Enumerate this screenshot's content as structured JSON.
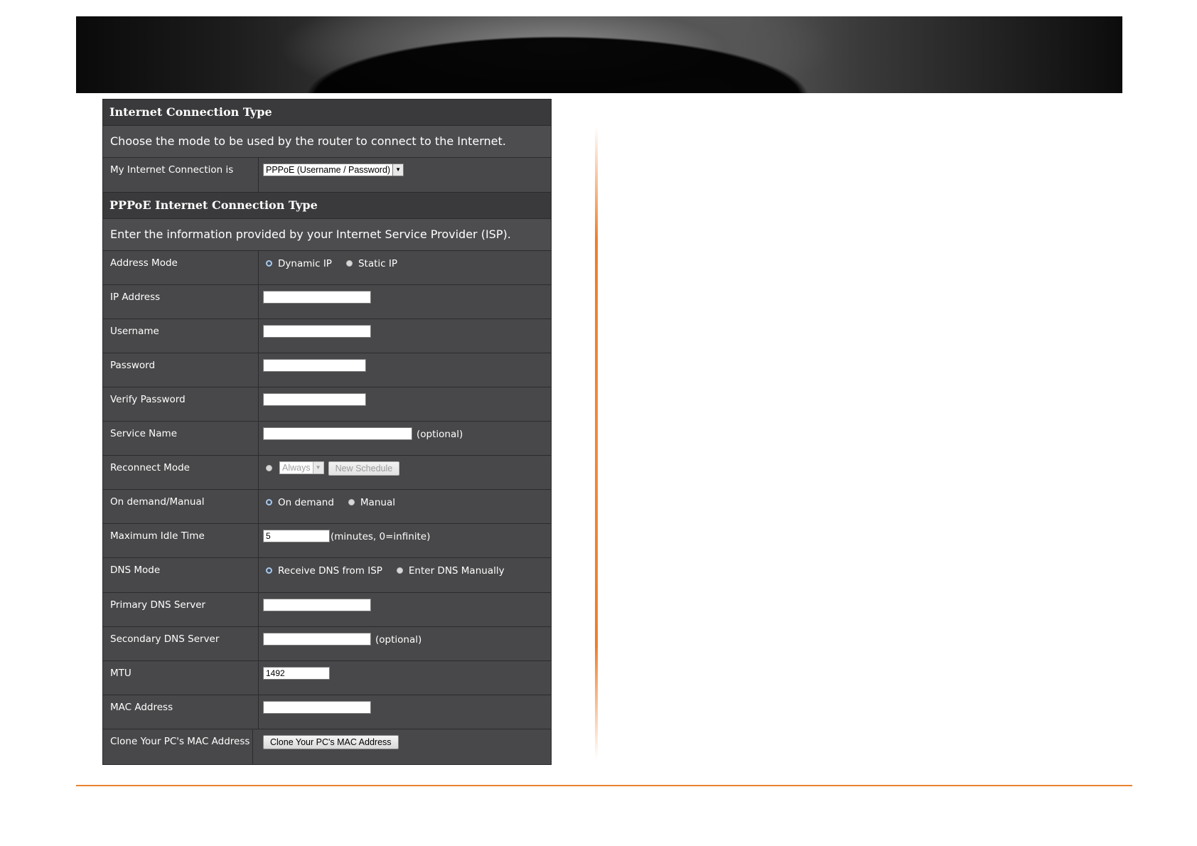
{
  "section1": {
    "title": "Internet Connection Type",
    "description": "Choose the mode to be used by the router to connect to the Internet.",
    "connection_label": "My Internet Connection is",
    "connection_value": "PPPoE (Username / Password)"
  },
  "section2": {
    "title": "PPPoE Internet Connection Type",
    "description": "Enter the information provided by your Internet Service Provider (ISP).",
    "address_mode": {
      "label": "Address Mode",
      "option1": "Dynamic IP",
      "option2": "Static IP",
      "selected": "Dynamic IP"
    },
    "ip_address": {
      "label": "IP Address",
      "value": ""
    },
    "username": {
      "label": "Username",
      "value": ""
    },
    "password": {
      "label": "Password",
      "value": ""
    },
    "verify_password": {
      "label": "Verify Password",
      "value": ""
    },
    "service_name": {
      "label": "Service Name",
      "value": "",
      "suffix": "(optional)"
    },
    "reconnect_mode": {
      "label": "Reconnect Mode",
      "schedule_value": "Always",
      "button": "New Schedule"
    },
    "on_demand": {
      "label": "On demand/Manual",
      "option1": "On demand",
      "option2": "Manual",
      "selected": "On demand"
    },
    "max_idle": {
      "label": "Maximum Idle Time",
      "value": "5",
      "suffix": "(minutes, 0=infinite)"
    },
    "dns_mode": {
      "label": "DNS Mode",
      "option1": "Receive DNS from ISP",
      "option2": "Enter DNS Manually",
      "selected": "Receive DNS from ISP"
    },
    "primary_dns": {
      "label": "Primary DNS Server",
      "value": ""
    },
    "secondary_dns": {
      "label": "Secondary DNS Server",
      "value": "",
      "suffix": "(optional)"
    },
    "mtu": {
      "label": "MTU",
      "value": "1492"
    },
    "mac_address": {
      "label": "MAC Address",
      "value": ""
    },
    "clone_mac": {
      "label": "Clone Your PC's MAC Address",
      "button": "Clone Your PC's MAC Address"
    }
  },
  "colors": {
    "panel_bg": "#48484a",
    "header_bg": "#3a3a3c",
    "accent_orange": "#ee7e2c"
  }
}
